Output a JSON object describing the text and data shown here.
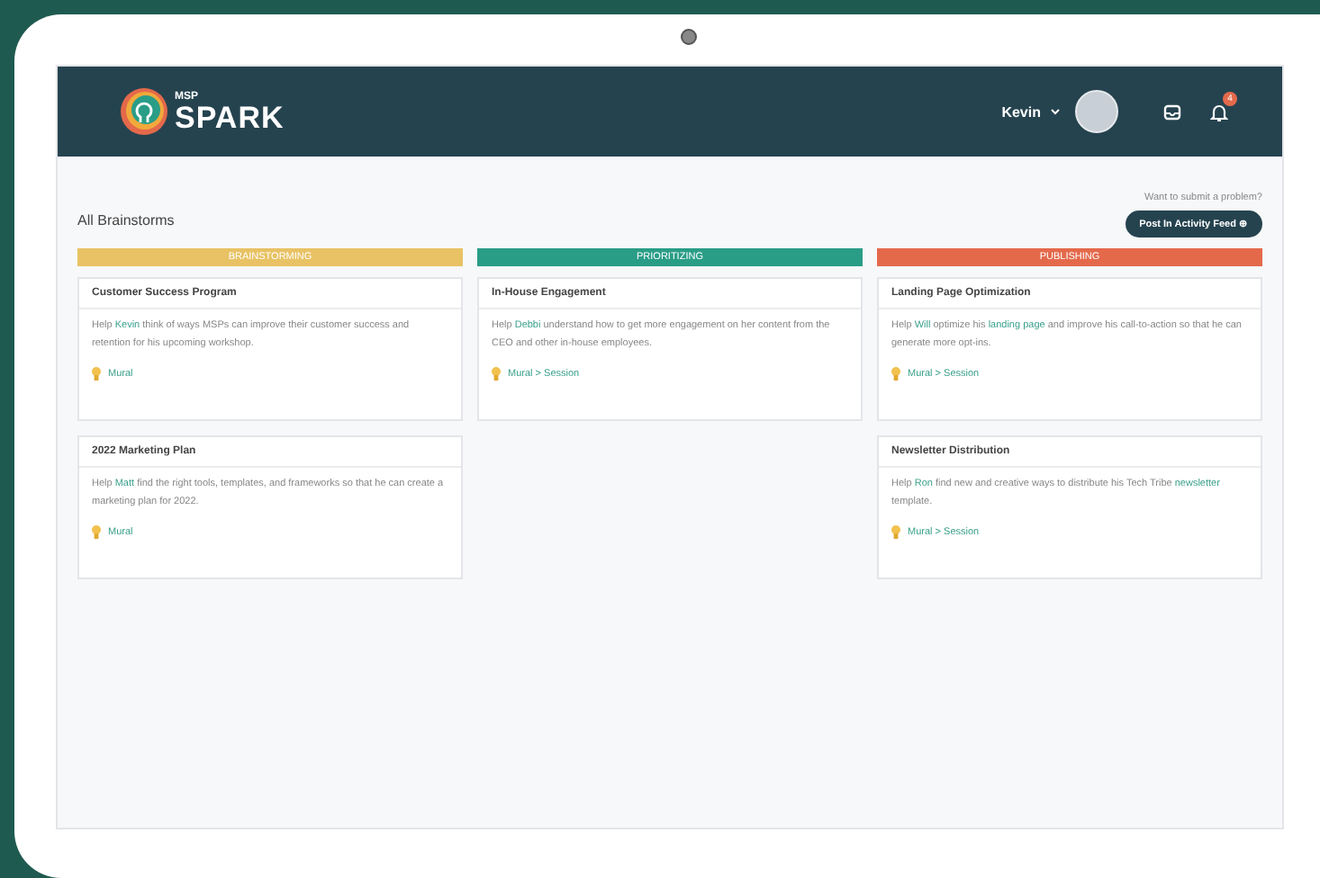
{
  "header": {
    "brand_small": "MSP",
    "brand": "SPARK",
    "user": "Kevin",
    "notification_count": "4"
  },
  "page": {
    "title": "All Brainstorms",
    "prompt": "Want to submit a problem?",
    "action": "Post In Activity Feed ⊕"
  },
  "columns": [
    {
      "title": "BRAINSTORMING",
      "color": "#e8c264",
      "cards": [
        {
          "title": "Customer Success Program",
          "description": [
            {
              "text": "Help ",
              "link": false
            },
            {
              "text": "Kevin",
              "link": true
            },
            {
              "text": " think of ways MSPs can improve their customer success and retention for his upcoming workshop.",
              "link": false
            }
          ],
          "tool": "Mural"
        },
        {
          "title": "2022 Marketing Plan",
          "description": [
            {
              "text": "Help ",
              "link": false
            },
            {
              "text": "Matt",
              "link": true
            },
            {
              "text": " find the right tools, templates, and frameworks so that he can create a marketing plan for 2022.",
              "link": false
            }
          ],
          "tool": "Mural"
        }
      ]
    },
    {
      "title": "PRIORITIZING",
      "color": "#2a9d87",
      "cards": [
        {
          "title": "In-House Engagement",
          "description": [
            {
              "text": "Help ",
              "link": false
            },
            {
              "text": "Debbi",
              "link": true
            },
            {
              "text": " understand how to get more engagement on her content from the CEO and other in-house employees.",
              "link": false
            }
          ],
          "tool": "Mural > Session"
        }
      ]
    },
    {
      "title": "PUBLISHING",
      "color": "#e4694b",
      "cards": [
        {
          "title": "Landing Page Optimization",
          "description": [
            {
              "text": "Help ",
              "link": false
            },
            {
              "text": "Will",
              "link": true
            },
            {
              "text": " optimize his ",
              "link": false
            },
            {
              "text": "landing page",
              "link": true
            },
            {
              "text": " and improve his call-to-action so that he can generate more opt-ins.",
              "link": false
            }
          ],
          "tool": "Mural > Session"
        },
        {
          "title": "Newsletter Distribution",
          "description": [
            {
              "text": "Help ",
              "link": false
            },
            {
              "text": "Ron",
              "link": true
            },
            {
              "text": " find new and creative ways to distribute his Tech Tribe ",
              "link": false
            },
            {
              "text": "newsletter",
              "link": true
            },
            {
              "text": " template.",
              "link": false
            }
          ],
          "tool": "Mural > Session"
        }
      ]
    }
  ]
}
